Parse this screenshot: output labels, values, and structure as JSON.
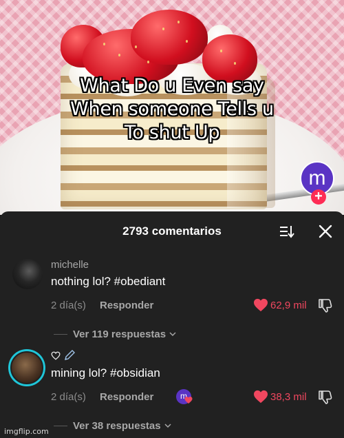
{
  "video": {
    "caption_lines": [
      "What Do u Even say",
      "When someone Tells u",
      "To shut Up"
    ],
    "creator_avatar_letter": "m",
    "follow_symbol": "+"
  },
  "comments_header": {
    "title": "2793 comentarios"
  },
  "comments": [
    {
      "username": "michelle",
      "text": "nothing lol? #obediant",
      "time": "2 día(s)",
      "reply_label": "Responder",
      "likes": "62,9 mil",
      "view_replies": "Ver 119 respuestas"
    },
    {
      "username": "",
      "text": "mining lol? #obsidian",
      "time": "2 día(s)",
      "reply_label": "Responder",
      "creator_badge_letter": "m",
      "likes": "38,3 mil",
      "view_replies": "Ver 38 respuestas"
    }
  ],
  "colors": {
    "like_red": "#f0475f",
    "creator_purple": "#5a34c4",
    "story_ring": "#1fc6d8"
  },
  "watermark": "imgflip.com"
}
